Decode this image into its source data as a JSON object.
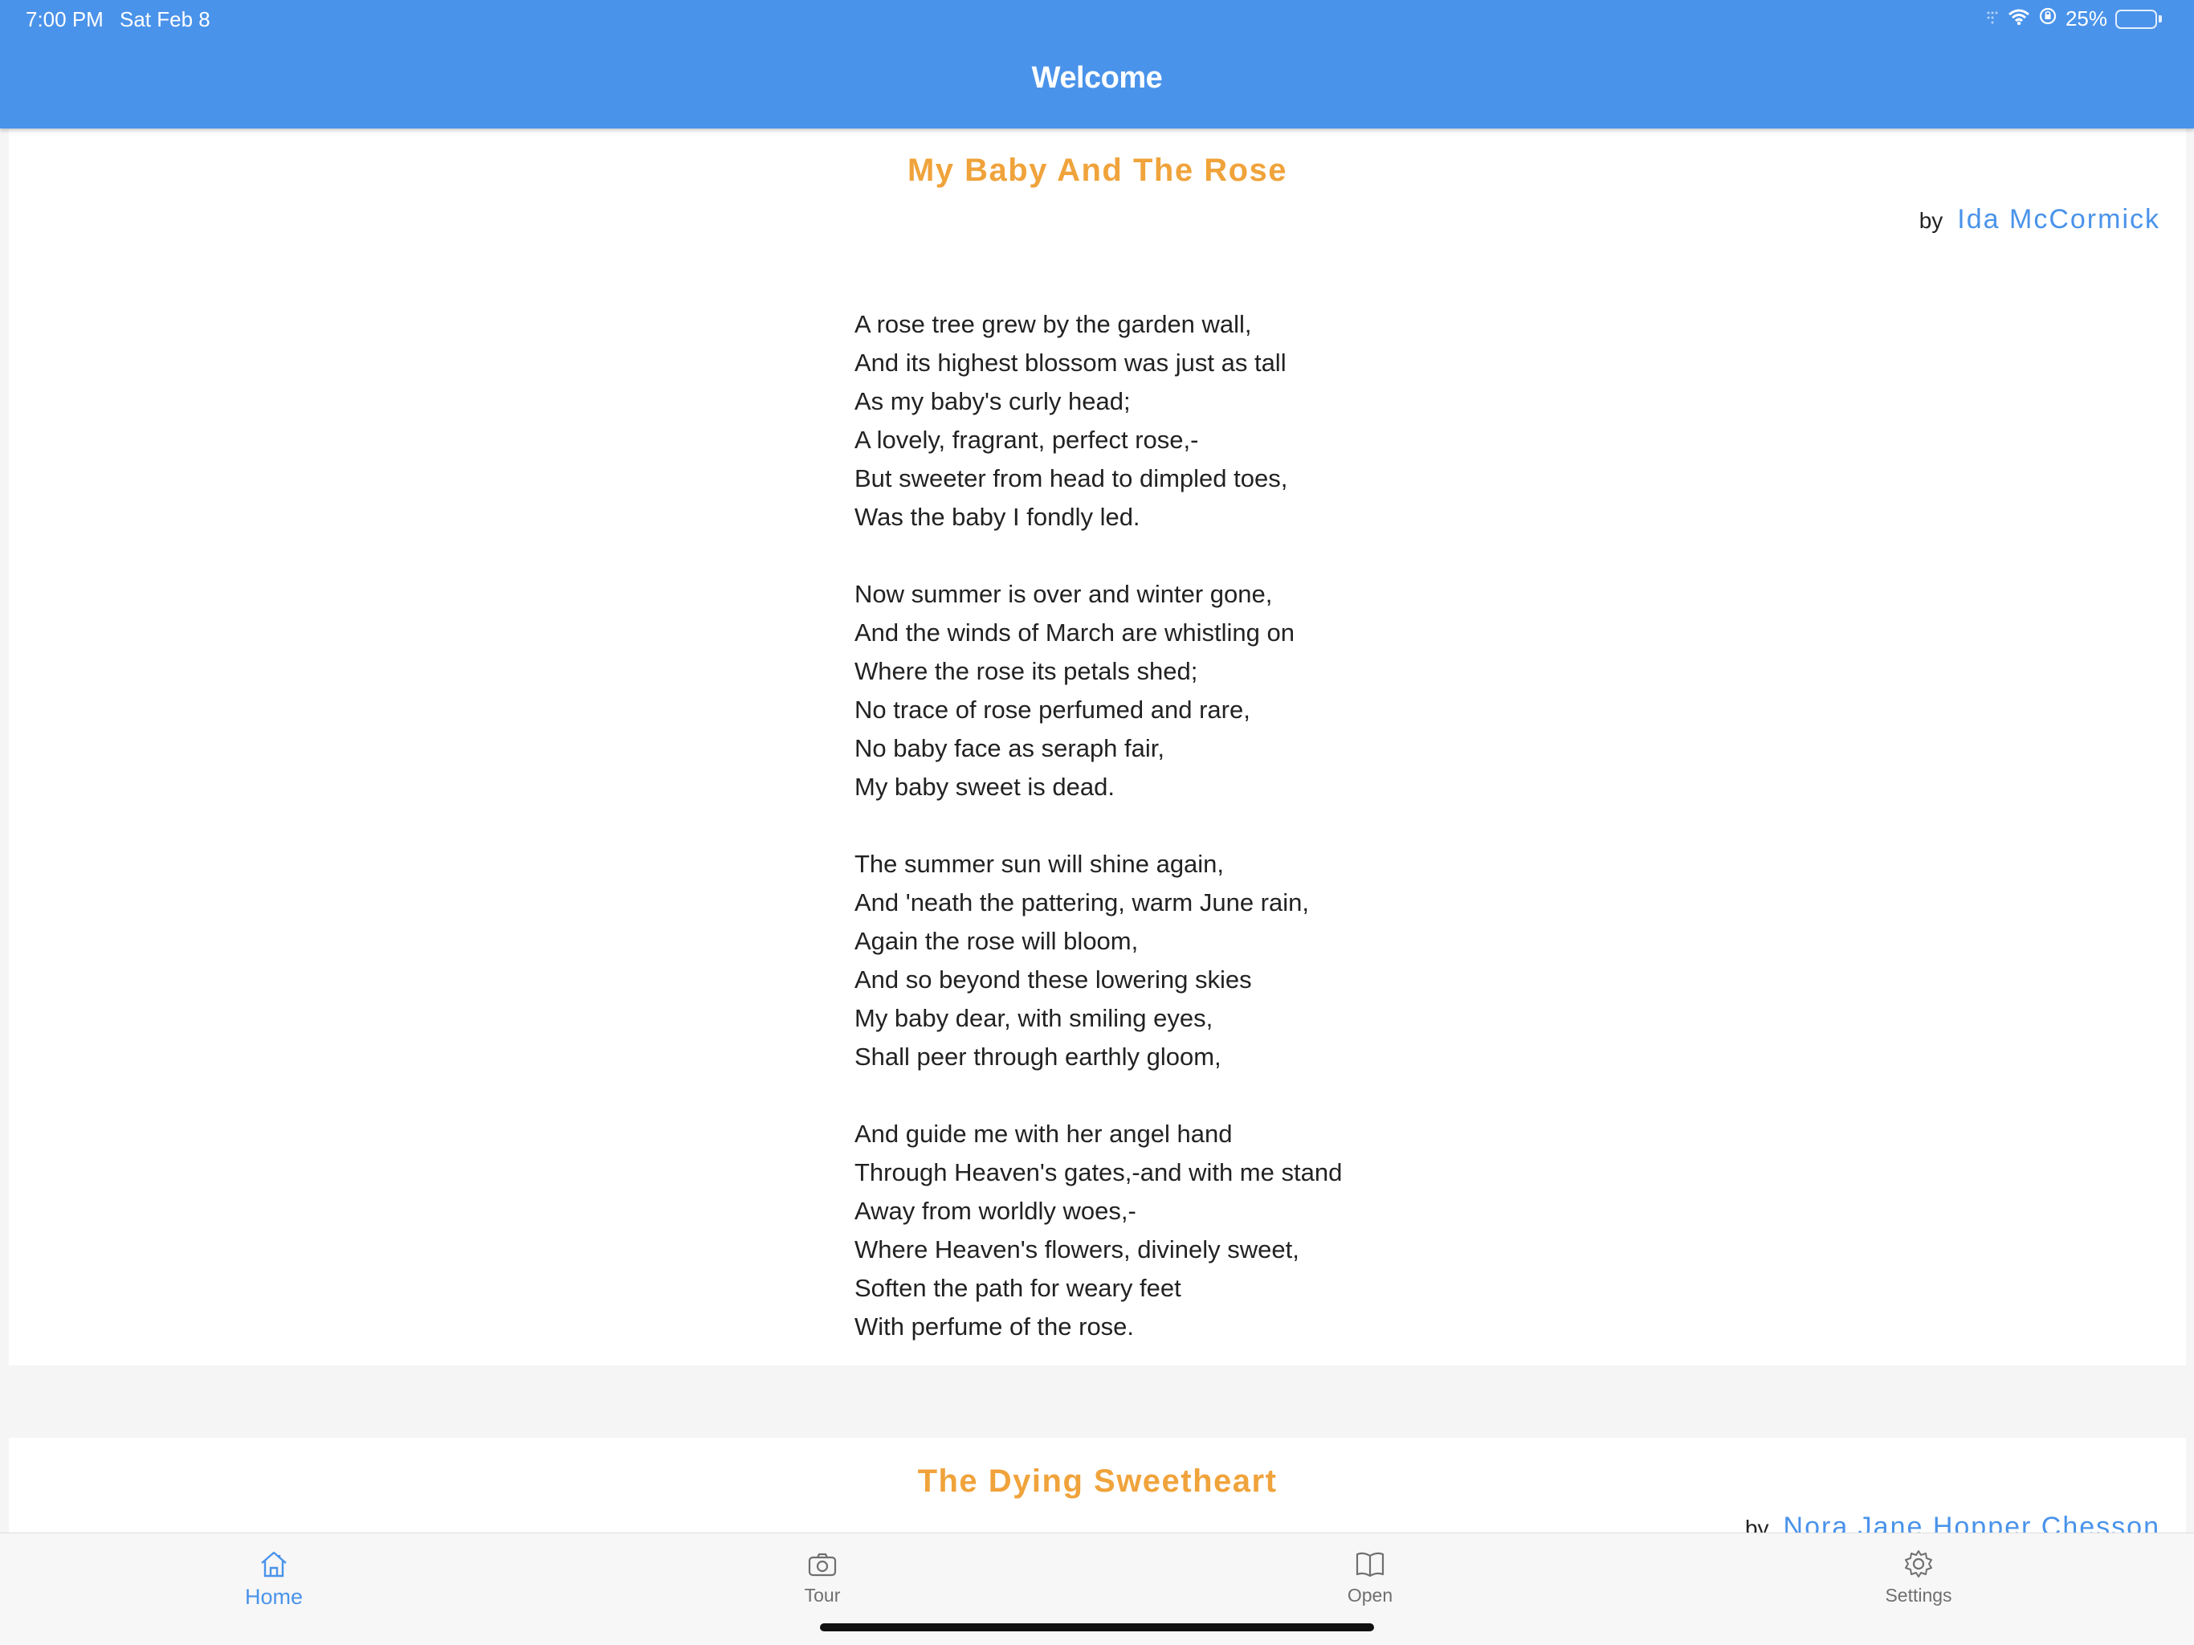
{
  "status_bar": {
    "time": "7:00 PM",
    "date": "Sat Feb 8",
    "battery": "25%",
    "battery_level": 0.25,
    "icons": [
      "signal-icon",
      "wifi-icon",
      "orientation-lock-icon",
      "battery-icon"
    ]
  },
  "nav": {
    "title": "Welcome"
  },
  "poems": [
    {
      "title": "My Baby And The Rose",
      "by": "by",
      "author": "Ida McCormick",
      "body": "A rose tree grew by the garden wall,\nAnd its highest blossom was just as tall\nAs my baby's curly head;\nA lovely, fragrant, perfect rose,-\nBut sweeter from head to dimpled toes,\nWas the baby I fondly led.\n\nNow summer is over and winter gone,\nAnd the winds of March are whistling on\nWhere the rose its petals shed;\nNo trace of rose perfumed and rare,\nNo baby face as seraph fair,\nMy baby sweet is dead.\n\nThe summer sun will shine again,\nAnd 'neath the pattering, warm June rain,\nAgain the rose will bloom,\nAnd so beyond these lowering skies\nMy baby dear, with smiling eyes,\nShall peer through earthly gloom,\n\nAnd guide me with her angel hand\nThrough Heaven's gates,-and with me stand\nAway from worldly woes,-\nWhere Heaven's flowers, divinely sweet,\nSoften the path for weary feet\nWith perfume of the rose."
    },
    {
      "title": "The Dying Sweetheart",
      "by": "by",
      "author": "Nora Jane Hopper Chesson"
    }
  ],
  "tabs": [
    {
      "label": "Home",
      "icon": "home-icon",
      "active": true
    },
    {
      "label": "Tour",
      "icon": "camera-icon",
      "active": false
    },
    {
      "label": "Open",
      "icon": "book-icon",
      "active": false
    },
    {
      "label": "Settings",
      "icon": "gear-icon",
      "active": false
    }
  ],
  "colors": {
    "accent": "#4a93ea",
    "title": "#f0a33b",
    "text": "#222222"
  }
}
